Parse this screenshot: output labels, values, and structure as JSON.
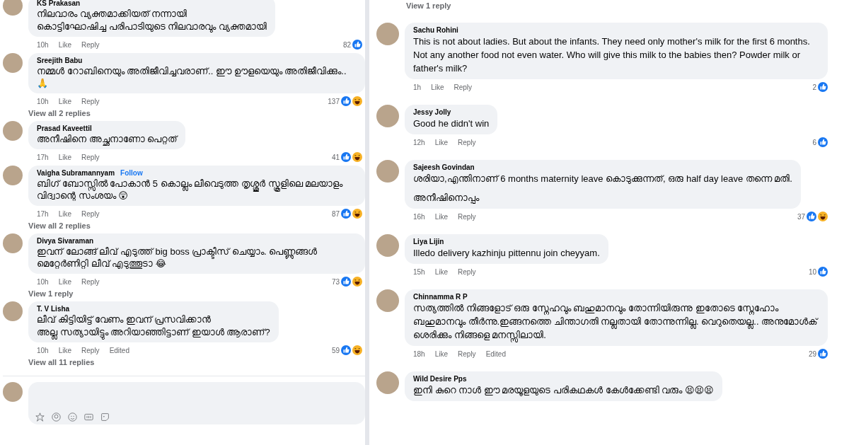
{
  "left_panel": {
    "comments": [
      {
        "author": "KS Prakasan",
        "lines": [
          "നിലവാരം വ്യക്തമാക്കിയത് നന്നായി",
          "കൊട്ടിഘോഷിച്ച പരിപാടിയുടെ നിലവാരവും വ്യക്തമായി"
        ],
        "time": "10h",
        "actions": [
          "Like",
          "Reply"
        ],
        "count": "82",
        "reactions": [
          {
            "kind": "like"
          }
        ]
      },
      {
        "author": "Sreejith Babu",
        "lines": [
          "നമ്മൾ റോബിനെയും അതിജീവിച്ചവരാണ്.. ഈ ഊളയെയും അതിജീവിക്കും..🙏"
        ],
        "time": "10h",
        "actions": [
          "Like",
          "Reply"
        ],
        "count": "137",
        "reactions": [
          {
            "kind": "like"
          },
          {
            "kind": "haha"
          }
        ],
        "replies_link": "View all 2 replies"
      },
      {
        "author": "Prasad Kaveettil",
        "lines": [
          "അനീഷിനെ അച്ഛനാണോ പെറ്റത്"
        ],
        "time": "17h",
        "actions": [
          "Like",
          "Reply"
        ],
        "count": "41",
        "reactions": [
          {
            "kind": "like"
          },
          {
            "kind": "haha"
          }
        ]
      },
      {
        "author": "Vaigha Subramannyam",
        "follow_link": "Follow",
        "lines": [
          "ബിഗ് ബോസ്സിൽ പോകാൻ 5 കൊല്ലം ലീവെടുത്ത തൃശ്ശൂർ സ്കൂളിലെ മലയാളം വിദ്വാന്റെ സംശയം 😲"
        ],
        "time": "17h",
        "actions": [
          "Like",
          "Reply"
        ],
        "count": "87",
        "reactions": [
          {
            "kind": "like"
          },
          {
            "kind": "haha"
          }
        ],
        "replies_link": "View all 2 replies"
      },
      {
        "author": "Divya Sivaraman",
        "lines": [
          "ഇവന് ലോങ്ങ് ലീവ് എടുത്ത് big boss പ്രാക്ടീസ് ചെയ്യാം. പെണ്ണുങ്ങൾ മെറ്റേർണിറ്റി ലീവ് എടുത്തൂടാ 😂"
        ],
        "time": "10h",
        "actions": [
          "Like",
          "Reply"
        ],
        "count": "73",
        "reactions": [
          {
            "kind": "like"
          },
          {
            "kind": "haha"
          }
        ],
        "replies_link": "View 1 reply"
      },
      {
        "author": "T. V Lisha",
        "lines": [
          "ലീവ് കിട്ടിയിട്ട് വേണം ഇവന് പ്രസവിക്കാൻ",
          "അല്ല സത്യായിട്ടും അറിയാഞ്ഞിട്ടാണ് ഇയാൾ ആരാണ്?"
        ],
        "time": "10h",
        "actions": [
          "Like",
          "Reply"
        ],
        "edited_label": "Edited",
        "count": "59",
        "reactions": [
          {
            "kind": "like"
          },
          {
            "kind": "haha"
          }
        ],
        "replies_link": "View all 11 replies"
      }
    ]
  },
  "right_panel": {
    "top_link": "View 1 reply",
    "comments": [
      {
        "author": "Sachu Rohini",
        "lines": [
          "This is not about ladies. But about the infants. They need only mother's milk for the first 6 months. Not any another food not even water. Who will give this milk to the babies then? Powder milk or father's milk?"
        ],
        "time": "1h",
        "actions": [
          "Like",
          "Reply"
        ],
        "count": "2",
        "reactions": [
          {
            "kind": "like"
          }
        ]
      },
      {
        "author": "Jessy Jolly",
        "lines": [
          "Good he didn't win"
        ],
        "time": "12h",
        "actions": [
          "Like",
          "Reply"
        ],
        "count": "6",
        "reactions": [
          {
            "kind": "like"
          }
        ]
      },
      {
        "author": "Sajeesh Govindan",
        "lines": [
          "ശരിയാ,എന്തിനാണ് 6 months maternity leave കൊടുക്കുന്നത്, ഒരു half day leave തന്നെ മതി.",
          "അനീഷിനൊപ്പം"
        ],
        "time": "16h",
        "actions": [
          "Like",
          "Reply"
        ],
        "count": "37",
        "reactions": [
          {
            "kind": "like"
          },
          {
            "kind": "haha"
          }
        ]
      },
      {
        "author": "Liya Lijin",
        "lines": [
          "Illedo delivery kazhinju pittennu join cheyyam."
        ],
        "time": "15h",
        "actions": [
          "Like",
          "Reply"
        ],
        "count": "10",
        "reactions": [
          {
            "kind": "like"
          }
        ]
      },
      {
        "author": "Chinnamma R P",
        "lines": [
          "സത്യത്തിൽ നിങ്ങളോട് ഒരു സ്നേഹവും ബഹുമാനവും തോന്നിയിരുന്നു ഇതോടെ സ്നേഹോം ബഹുമാനവും തീർന്നു.ഇങ്ങനത്തെ ചിന്താഗതി നല്ലതായി തോന്നുന്നില്ല. വെറുതെയല്ല.. അനുമോൾക് ശെരിക്കും നിങ്ങളെ മനസ്സിലായി."
        ],
        "time": "18h",
        "actions": [
          "Like",
          "Reply"
        ],
        "edited_label": "Edited",
        "count": "29",
        "reactions": [
          {
            "kind": "like"
          }
        ]
      },
      {
        "author": "Wild Desire Pps",
        "lines": [
          "ഇനി കുറെ നാൾ ഈ മരയൂളയുടെ പരികഥകൾ കേൾക്കേണ്ടി വരും 😫😫😫"
        ]
      }
    ]
  }
}
